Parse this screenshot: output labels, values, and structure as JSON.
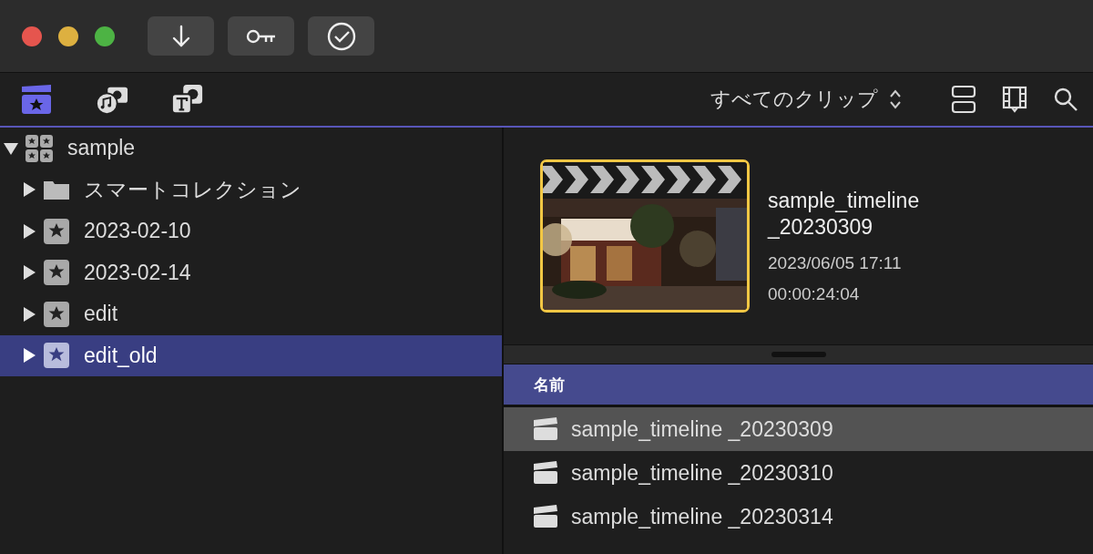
{
  "window": {
    "traffic_lights": [
      {
        "kind": "close"
      },
      {
        "kind": "minimize"
      },
      {
        "kind": "zoom"
      }
    ]
  },
  "toolbar": {
    "buttons": [
      {
        "kind": "import"
      },
      {
        "kind": "keywords"
      },
      {
        "kind": "analyze"
      }
    ]
  },
  "browser_tabs": [
    {
      "kind": "libraries",
      "selected": true
    },
    {
      "kind": "photos",
      "selected": false
    },
    {
      "kind": "titles",
      "selected": false
    }
  ],
  "filter": {
    "label": "すべてのクリップ"
  },
  "sidebar": {
    "items": [
      {
        "label": "sample",
        "kind": "library",
        "expanded": true,
        "selected": false,
        "children": [
          {
            "label": "スマートコレクション",
            "kind": "folder",
            "expanded": false,
            "selected": false
          },
          {
            "label": "2023-02-10",
            "kind": "event",
            "expanded": false,
            "selected": false
          },
          {
            "label": "2023-02-14",
            "kind": "event",
            "expanded": false,
            "selected": false
          },
          {
            "label": "edit",
            "kind": "event",
            "expanded": false,
            "selected": false
          },
          {
            "label": "edit_old",
            "kind": "event",
            "expanded": false,
            "selected": true
          }
        ]
      }
    ]
  },
  "clip": {
    "kind": "picture",
    "title": "sample_timeline _20230309",
    "date": "2023/06/05 17:11",
    "duration": "00:00:24:04"
  },
  "table": {
    "columns": [
      "名前"
    ],
    "rows": [
      {
        "name": "sample_timeline _20230309",
        "selected": true
      },
      {
        "name": "sample_timeline _20230310",
        "selected": false
      },
      {
        "name": "sample_timeline _20230314",
        "selected": false
      }
    ]
  }
}
